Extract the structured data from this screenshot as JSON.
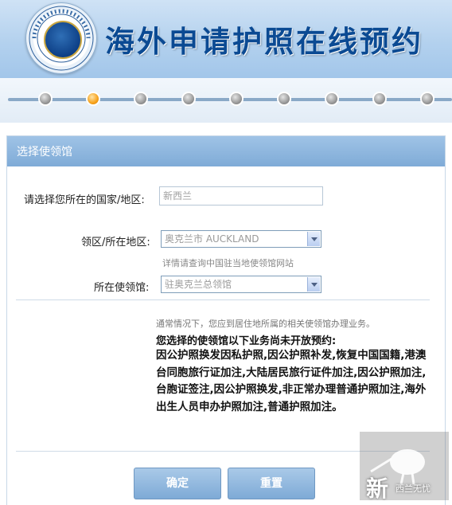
{
  "header": {
    "title": "海外申请护照在线预约",
    "logo_name": "consular-emblem"
  },
  "progress": {
    "total_steps": 9,
    "active_step": 2
  },
  "panel": {
    "title": "选择使领馆"
  },
  "form": {
    "country_label": "请选择您所在的国家/地区:",
    "country_value": "新西兰",
    "region_label": "领区/所在地区:",
    "region_value": "奥克兰市 AUCKLAND",
    "region_hint": "详情请查询中国驻当地使领馆网站",
    "consulate_label": "所在使领馆:",
    "consulate_value": "驻奥克兰总领馆"
  },
  "notice": {
    "note": "通常情况下，您应到居住地所属的相关使领馆办理业务。",
    "title": "您选择的使领馆以下业务尚未开放预约:",
    "body": "因公护照换发因私护照,因公护照补发,恢复中国国籍,港澳台同胞旅行证加注,大陆居民旅行证件加注,因公护照加注,台胞证签注,因公护照换发,非正常办理普通护照加注,海外出生人员申办护照加注,普通护照加注。"
  },
  "buttons": {
    "confirm": "确定",
    "reset": "重置"
  },
  "watermark": {
    "char": "新",
    "text": "西兰无忧"
  },
  "colors": {
    "title_blue": "#0b4a93",
    "panel_header": "#8db6dd",
    "active_step": "#f7a21b"
  }
}
